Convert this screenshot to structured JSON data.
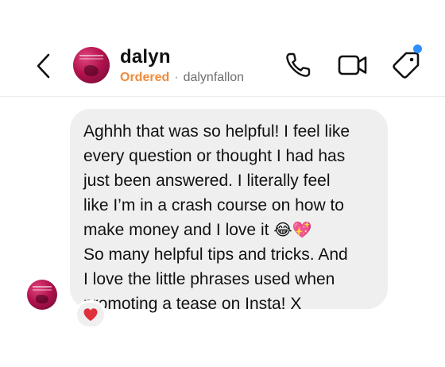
{
  "header": {
    "name": "dalyn",
    "status": "Ordered",
    "separator": "·",
    "username": "dalynfallon",
    "icons": {
      "back": "chevron-left-icon",
      "phone": "phone-icon",
      "video": "video-camera-icon",
      "tag": "tag-icon"
    },
    "notification_dot_color": "#2f8fff",
    "status_color": "#ef8b3c"
  },
  "message": {
    "lines": [
      "Aghhh that was so helpful! I feel like",
      "every question or thought I had has",
      "just been answered. I literally feel",
      "like I’m in a crash course on how to",
      "make money and I love it",
      "So many helpful tips and tricks. And",
      "I love the little phrases used when",
      "promoting a tease on Insta! X"
    ],
    "emojis": [
      "😂",
      "💖"
    ],
    "bubble_color": "#efefef"
  },
  "reaction": {
    "emoji": "heart-icon",
    "color": "#e0303c"
  }
}
